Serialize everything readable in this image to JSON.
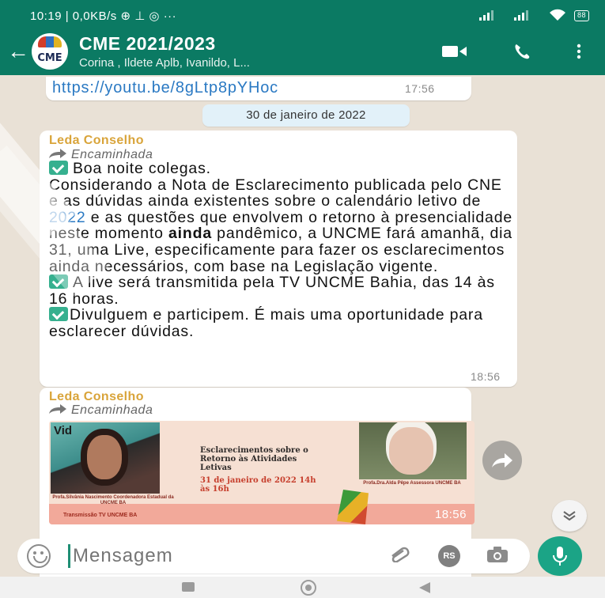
{
  "status_bar": {
    "left_text": "10:19 | 0,0KB/s ⊕ ⊥ ◎ ···",
    "battery": "88"
  },
  "header": {
    "title": "CME 2021/2023",
    "subtitle": "Corina , Ildete Aplb, Ivanildo, L...",
    "avatar_text": "CME",
    "icons": [
      "video-call-icon",
      "voice-call-icon",
      "more-options-icon"
    ]
  },
  "chat": {
    "link_message": {
      "text": "https://youtu.be/8gLtp8pYHoc",
      "time": "17:56"
    },
    "date_separator": "30 de janeiro de 2022",
    "message1": {
      "sender": "Leda Conselho",
      "forwarded": "Encaminhada",
      "line1": "Boa noite colegas.",
      "para1_a": "Considerando  a Nota de Esclarecimento publicada pelo CNE e as dúvidas ainda existentes sobre o calendário letivo de ",
      "year": "2022",
      "para1_b": " e as questões que envolvem o retorno à presencialidade neste momento ",
      "bold_word": "ainda",
      "para1_c": " pandêmico,  a UNCME fará amanhã, dia 31, uma Live, especificamente para fazer os esclarecimentos ainda necessários, com base na Legislação vigente.",
      "line2": "A live será transmitida pela TV UNCME Bahia,  das 14 às 16 horas.",
      "line3": "Divulguem e participem. É mais uma oportunidade para esclarecer dúvidas.",
      "time": "18:56"
    },
    "message2": {
      "sender": "Leda Conselho",
      "forwarded": "Encaminhada",
      "media": {
        "corner_text": "Vid",
        "title": "Esclarecimentos sobre o Retorno às Atividades Letivas",
        "date": "31 de janeiro de 2022 14h às 16h",
        "caption_left": "Profa.Silvânia Nascimento Coordenadora Estadual da UNCME BA",
        "caption_right": "Profa.Dra.Alda Pêpe Assessora UNCME BA",
        "footer": "Transmissão TV UNCME BA",
        "time": "18:56"
      }
    }
  },
  "input": {
    "placeholder": "Mensagem",
    "rs_badge": "RS"
  },
  "colors": {
    "header_green": "#0b7a63",
    "accent_green": "#1ba486",
    "chat_bg": "#e9e1d6",
    "sender_color": "#d9a43a",
    "link_blue": "#2a79c3"
  }
}
